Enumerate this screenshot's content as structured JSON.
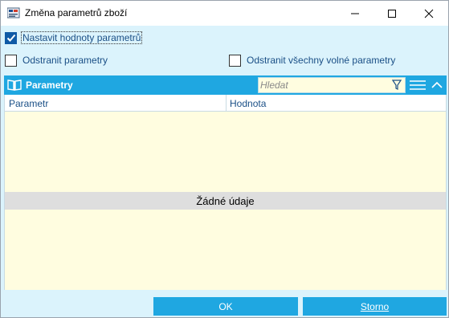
{
  "window": {
    "title": "Změna parametrů zboží"
  },
  "options": {
    "set_values": {
      "label": "Nastavit hodnoty parametrů",
      "checked": true
    },
    "remove_params": {
      "label": "Odstranit parametry",
      "checked": false
    },
    "remove_all_free": {
      "label": "Odstranit všechny volné parametry",
      "checked": false
    }
  },
  "panel": {
    "title": "Parametry",
    "search_placeholder": "Hledat",
    "columns": [
      "Parametr",
      "Hodnota"
    ],
    "empty_text": "Žádné údaje"
  },
  "buttons": {
    "ok": "OK",
    "cancel": "Storno"
  },
  "colors": {
    "accent": "#1fa7e1",
    "checkbox_checked": "#0f5aa6",
    "grid_bg": "#fffde0",
    "dialog_bg": "#dbf3fc"
  }
}
